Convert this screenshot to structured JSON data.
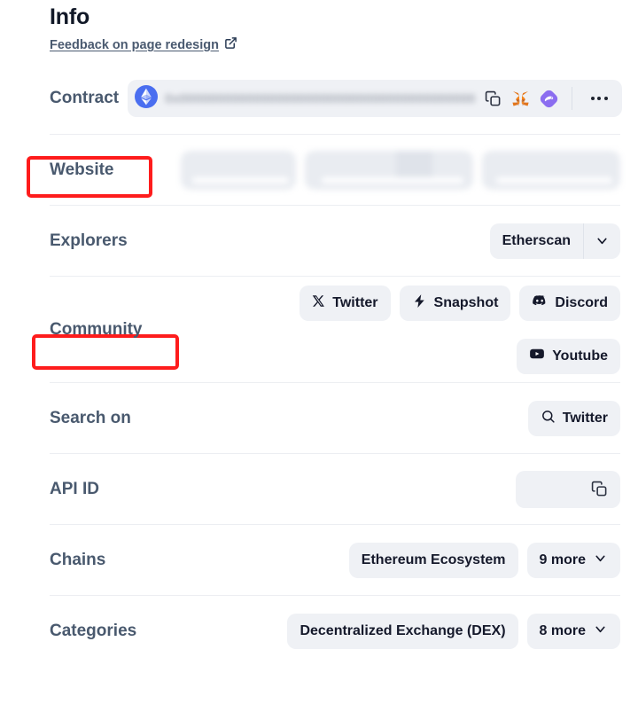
{
  "header": {
    "title": "Info",
    "feedback_label": "Feedback on page redesign",
    "external_link_icon": "external-link-icon"
  },
  "rows": {
    "contract": {
      "label": "Contract",
      "chain_icon": "ethereum-icon",
      "address": "0x0000000000000000000000000000000000000000",
      "address_redacted": true,
      "copy_icon": "copy-icon",
      "metamask_icon": "metamask-fox-icon",
      "rabby_icon": "rabby-wallet-icon",
      "more_icon": "more-horizontal-icon"
    },
    "website": {
      "label": "Website",
      "links_redacted": true,
      "link_count": 3,
      "annotated": true,
      "annotation_color": "#fe1c1c"
    },
    "explorers": {
      "label": "Explorers",
      "selected": "Etherscan",
      "caret_icon": "chevron-down-icon"
    },
    "community": {
      "label": "Community",
      "annotated": true,
      "annotation_color": "#fe1c1c",
      "chips": [
        {
          "label": "Twitter",
          "icon": "x-twitter-icon"
        },
        {
          "label": "Snapshot",
          "icon": "lightning-bolt-icon"
        },
        {
          "label": "Discord",
          "icon": "discord-icon"
        },
        {
          "label": "Youtube",
          "icon": "youtube-icon"
        }
      ]
    },
    "search_on": {
      "label": "Search on",
      "chip_label": "Twitter",
      "chip_icon": "search-icon"
    },
    "api_id": {
      "label": "API ID",
      "value": "",
      "value_redacted": true,
      "copy_icon": "copy-icon"
    },
    "chains": {
      "label": "Chains",
      "primary": "Ethereum Ecosystem",
      "more_label": "9 more",
      "caret_icon": "chevron-down-icon"
    },
    "categories": {
      "label": "Categories",
      "primary": "Decentralized Exchange (DEX)",
      "more_label": "8 more",
      "caret_icon": "chevron-down-icon"
    }
  },
  "colors": {
    "label": "#49596e",
    "chip_bg": "#eff1f5",
    "chip_text": "#15192b",
    "divider": "#eceef2",
    "annotation": "#fe1c1c",
    "title": "#111827"
  }
}
